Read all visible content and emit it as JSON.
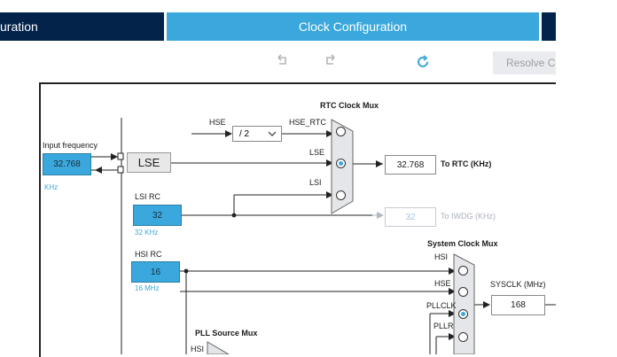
{
  "tabs": {
    "left_label": "uration",
    "active_label": "Clock Configuration"
  },
  "toolbar": {
    "undo_icon": "undo-icon",
    "redo_icon": "redo-icon",
    "refresh_icon": "refresh-icon",
    "resolve_label": "Resolve C"
  },
  "colors": {
    "nav_dark": "#03234b",
    "accent_blue": "#3aa8dc"
  },
  "input_frequency": {
    "label": "Input frequency",
    "value": "32.768",
    "unit": "KHz"
  },
  "lse": {
    "label": "LSE"
  },
  "lsi_rc": {
    "label": "LSI RC",
    "value": "32",
    "unit": "32 KHz"
  },
  "hsi_rc": {
    "label": "HSI RC",
    "value": "16",
    "unit": "16 MHz"
  },
  "rtc_mux": {
    "title": "RTC Clock Mux",
    "hse_label": "HSE",
    "divider_value": "/ 2",
    "hse_rtc_label": "HSE_RTC",
    "lse_label": "LSE",
    "lsi_label": "LSI",
    "selected": "LSE"
  },
  "rtc_output": {
    "value": "32.768",
    "label": "To RTC (KHz)"
  },
  "iwdg_output": {
    "value": "32",
    "label": "To IWDG (KHz)"
  },
  "system_mux": {
    "title": "System Clock Mux",
    "hsi_label": "HSI",
    "hse_label": "HSE",
    "pllclk_label": "PLLCLK",
    "pllr_label": "PLLR",
    "selected": "PLLCLK"
  },
  "sysclk": {
    "label": "SYSCLK (MHz)",
    "value": "168"
  },
  "pll_source_mux": {
    "title": "PLL Source Mux",
    "hsi_label": "HSI"
  }
}
